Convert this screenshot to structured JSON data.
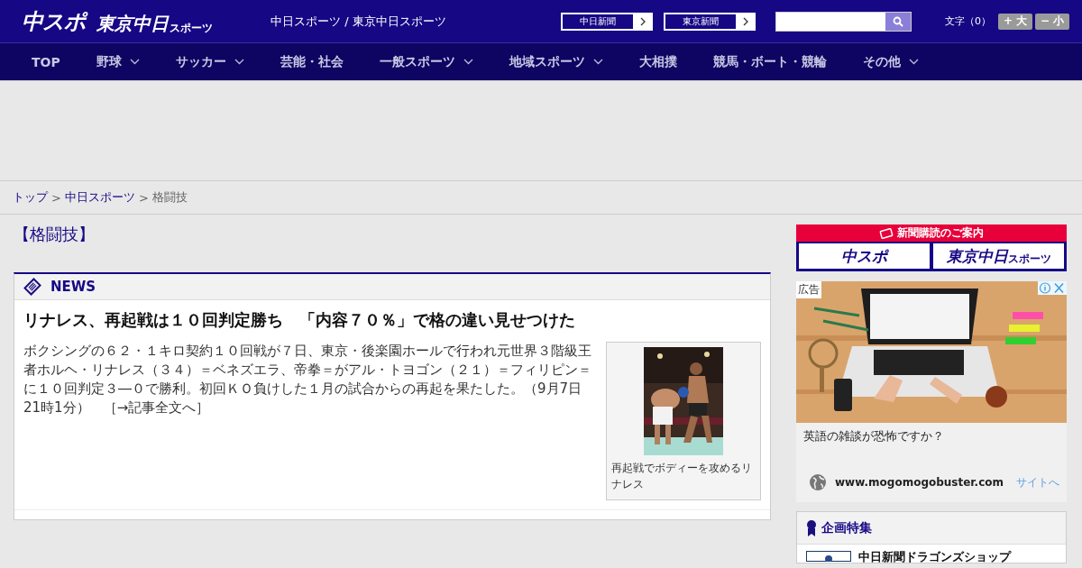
{
  "header": {
    "logo_main": "中スポ",
    "logo_sub": "東京中日",
    "logo_small": "スポーツ",
    "site_title": "中日スポーツ / 東京中日スポーツ",
    "paper_links": [
      {
        "label": "中日新聞"
      },
      {
        "label": "東京新聞"
      }
    ],
    "font_size_label": "文字（0）",
    "font_buttons": [
      {
        "label": "+ 大"
      },
      {
        "label": "− 小"
      }
    ]
  },
  "nav": [
    {
      "label": "TOP",
      "has_menu": false
    },
    {
      "label": "野球",
      "has_menu": true
    },
    {
      "label": "サッカー",
      "has_menu": true
    },
    {
      "label": "芸能・社会",
      "has_menu": false
    },
    {
      "label": "一般スポーツ",
      "has_menu": true
    },
    {
      "label": "地域スポーツ",
      "has_menu": true
    },
    {
      "label": "大相撲",
      "has_menu": false
    },
    {
      "label": "競馬・ボート・競輪",
      "has_menu": false
    },
    {
      "label": "その他",
      "has_menu": true
    }
  ],
  "breadcrumb": [
    {
      "label": "トップ",
      "link": true
    },
    {
      "separator": ">",
      "label": "中日スポーツ",
      "link": true
    },
    {
      "separator": ">",
      "label": "格闘技",
      "link": false
    }
  ],
  "category_title": "【格闘技】",
  "news": {
    "heading": "NEWS",
    "headline": "リナレス、再起戦は１０回判定勝ち　「内容７０％」で格の違い見せつけた",
    "body": "ボクシングの６２・１キロ契約１０回戦が７日、東京・後楽園ホールで行われ元世界３階級王者ホルヘ・リナレス（３４）＝ベネズエラ、帝拳＝がアル・トヨゴン（２１）＝フィリピン＝に１０回判定３―０で勝利。初回ＫＯ負けした１月の試合からの再起を果たした。（9月7日 21時1分）",
    "more_link": "［→記事全文へ］",
    "photo": {
      "kind": "picture",
      "caption": "再起戦でボディーを攻めるリナレス"
    }
  },
  "sidebar": {
    "subscribe": {
      "title": "新聞購読のご案内",
      "logos": [
        {
          "main": "中スポ"
        },
        {
          "main": "東京中日",
          "small": "スポーツ"
        }
      ]
    },
    "ad": {
      "badge": "広告",
      "text": "英語の雑談が恐怖ですか？",
      "url": "www.mogomogobuster.com",
      "cta": "サイトへ"
    },
    "features": {
      "heading": "企画特集",
      "items": [
        {
          "title": "中日新聞ドラゴンズショップ"
        }
      ]
    }
  }
}
